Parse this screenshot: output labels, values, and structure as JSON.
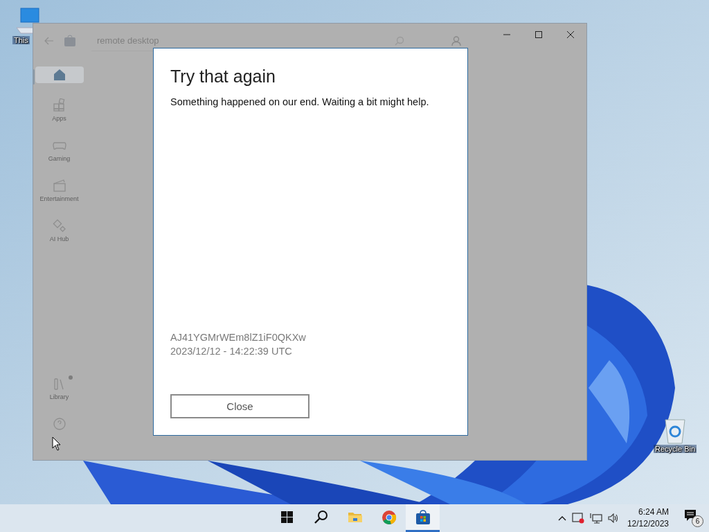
{
  "desktop_icons": [
    {
      "label": "This"
    },
    {
      "label": "Recycle Bin"
    }
  ],
  "store_window": {
    "search": {
      "value": "remote desktop"
    },
    "sidebar": {
      "items": [
        {
          "selected": true,
          "notification_dot": false
        },
        {
          "label": "Apps",
          "selected": false,
          "notification_dot": false
        },
        {
          "label": "Gaming",
          "selected": false,
          "notification_dot": false
        },
        {
          "label": "Entertainment",
          "selected": false,
          "notification_dot": false
        },
        {
          "label": "AI Hub",
          "selected": false,
          "notification_dot": false
        },
        {
          "label": "Library",
          "selected": false,
          "notification_dot": true
        },
        {
          "selected": false,
          "notification_dot": false
        }
      ]
    }
  },
  "dialog": {
    "title": "Try that again",
    "message": "Something happened on our end. Waiting a bit might help.",
    "error_code": "AJ41YGMrWEm8lZ1iF0QKXw",
    "timestamp": "2023/12/12 - 14:22:39 UTC",
    "button": "Close"
  },
  "taskbar": {
    "apps": [
      {
        "selected": false
      },
      {
        "selected": false
      },
      {
        "selected": false
      },
      {
        "selected": false
      },
      {
        "selected": true
      }
    ],
    "time": "6:24 AM",
    "date": "12/12/2023",
    "notification_count": "6"
  }
}
